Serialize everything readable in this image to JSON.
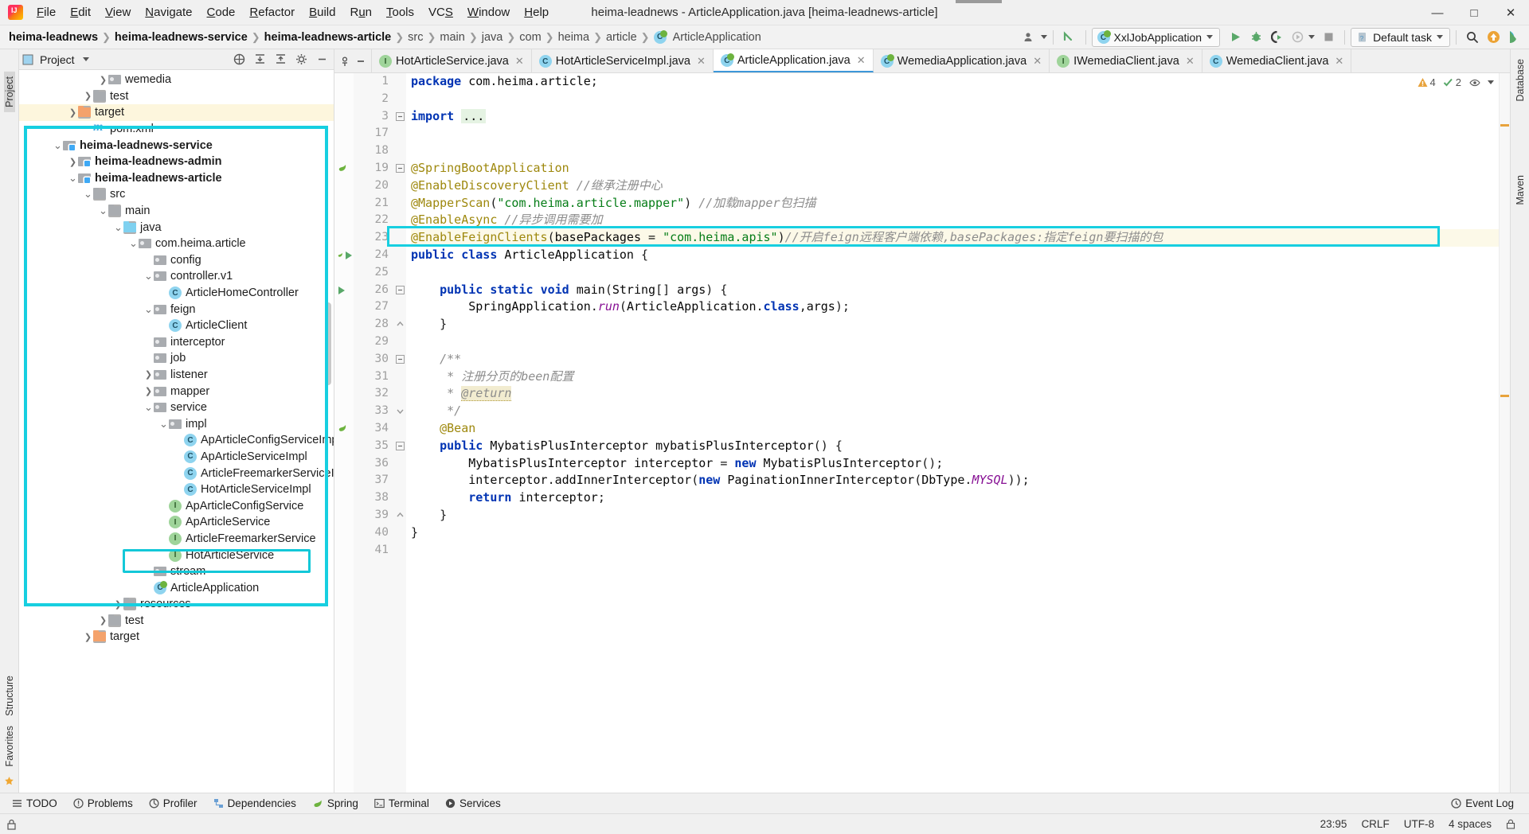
{
  "titlebar": {
    "app_icon": "intellij-logo-icon",
    "menus": [
      "File",
      "Edit",
      "View",
      "Navigate",
      "Code",
      "Refactor",
      "Build",
      "Run",
      "Tools",
      "VCS",
      "Window",
      "Help"
    ],
    "window_title": "heima-leadnews - ArticleApplication.java [heima-leadnews-article]",
    "minimize": "—",
    "maximize": "□",
    "close": "✕"
  },
  "navbar": {
    "breadcrumbs": [
      {
        "label": "heima-leadnews",
        "bold": true
      },
      {
        "label": "heima-leadnews-service",
        "bold": true
      },
      {
        "label": "heima-leadnews-article",
        "bold": true
      },
      {
        "label": "src",
        "bold": false
      },
      {
        "label": "main",
        "bold": false
      },
      {
        "label": "java",
        "bold": false
      },
      {
        "label": "com",
        "bold": false
      },
      {
        "label": "heima",
        "bold": false
      },
      {
        "label": "article",
        "bold": false
      },
      {
        "label": "ArticleApplication",
        "bold": false,
        "icon": "spring-class-icon"
      }
    ],
    "separator": "›",
    "run_config": "XxlJobApplication",
    "task_selector": "Default task",
    "icons": [
      "user-avatar-icon",
      "vcs-update-icon",
      "run-icon",
      "debug-icon",
      "run-coverage-icon",
      "profiler-icon",
      "stop-icon",
      "search-icon",
      "update-icon",
      "ide-icon"
    ]
  },
  "project_panel": {
    "header_title": "Project",
    "header_icons": [
      "collapse-scope-icon",
      "expand-all-icon",
      "collapse-all-icon",
      "settings-gear-icon",
      "hide-icon"
    ],
    "tree": [
      {
        "label": "wemedia",
        "indent": 5,
        "arrow": "collapsed",
        "icon": "package-icon",
        "bold": false
      },
      {
        "label": "test",
        "indent": 4,
        "arrow": "collapsed",
        "icon": "folder-icon",
        "bold": false
      },
      {
        "label": "target",
        "indent": 3,
        "arrow": "collapsed",
        "icon": "folder-target-icon",
        "bold": false,
        "highlight": true
      },
      {
        "label": "pom.xml",
        "indent": 4,
        "arrow": "none",
        "icon": "maven-icon",
        "bold": false
      },
      {
        "label": "heima-leadnews-service",
        "indent": 2,
        "arrow": "expanded",
        "icon": "module-icon",
        "bold": true
      },
      {
        "label": "heima-leadnews-admin",
        "indent": 3,
        "arrow": "collapsed",
        "icon": "module-icon",
        "bold": true
      },
      {
        "label": "heima-leadnews-article",
        "indent": 3,
        "arrow": "expanded",
        "icon": "module-icon",
        "bold": true
      },
      {
        "label": "src",
        "indent": 4,
        "arrow": "expanded",
        "icon": "folder-icon",
        "bold": false
      },
      {
        "label": "main",
        "indent": 5,
        "arrow": "expanded",
        "icon": "folder-icon",
        "bold": false
      },
      {
        "label": "java",
        "indent": 6,
        "arrow": "expanded",
        "icon": "folder-src-icon",
        "bold": false
      },
      {
        "label": "com.heima.article",
        "indent": 7,
        "arrow": "expanded",
        "icon": "package-icon",
        "bold": false
      },
      {
        "label": "config",
        "indent": 8,
        "arrow": "none",
        "icon": "package-icon",
        "bold": false
      },
      {
        "label": "controller.v1",
        "indent": 8,
        "arrow": "expanded",
        "icon": "package-icon",
        "bold": false
      },
      {
        "label": "ArticleHomeController",
        "indent": 9,
        "arrow": "none",
        "icon": "class-icon",
        "bold": false
      },
      {
        "label": "feign",
        "indent": 8,
        "arrow": "expanded",
        "icon": "package-icon",
        "bold": false
      },
      {
        "label": "ArticleClient",
        "indent": 9,
        "arrow": "none",
        "icon": "class-icon",
        "bold": false
      },
      {
        "label": "interceptor",
        "indent": 8,
        "arrow": "none",
        "icon": "package-icon",
        "bold": false
      },
      {
        "label": "job",
        "indent": 8,
        "arrow": "none",
        "icon": "package-icon",
        "bold": false
      },
      {
        "label": "listener",
        "indent": 8,
        "arrow": "collapsed",
        "icon": "package-icon",
        "bold": false
      },
      {
        "label": "mapper",
        "indent": 8,
        "arrow": "collapsed",
        "icon": "package-icon",
        "bold": false
      },
      {
        "label": "service",
        "indent": 8,
        "arrow": "expanded",
        "icon": "package-icon",
        "bold": false
      },
      {
        "label": "impl",
        "indent": 9,
        "arrow": "expanded",
        "icon": "package-icon",
        "bold": false
      },
      {
        "label": "ApArticleConfigServiceImpl",
        "indent": 10,
        "arrow": "none",
        "icon": "class-icon",
        "bold": false
      },
      {
        "label": "ApArticleServiceImpl",
        "indent": 10,
        "arrow": "none",
        "icon": "class-icon",
        "bold": false
      },
      {
        "label": "ArticleFreemarkerServiceImp",
        "indent": 10,
        "arrow": "none",
        "icon": "class-icon",
        "bold": false
      },
      {
        "label": "HotArticleServiceImpl",
        "indent": 10,
        "arrow": "none",
        "icon": "class-icon",
        "bold": false
      },
      {
        "label": "ApArticleConfigService",
        "indent": 9,
        "arrow": "none",
        "icon": "interface-icon",
        "bold": false
      },
      {
        "label": "ApArticleService",
        "indent": 9,
        "arrow": "none",
        "icon": "interface-icon",
        "bold": false
      },
      {
        "label": "ArticleFreemarkerService",
        "indent": 9,
        "arrow": "none",
        "icon": "interface-icon",
        "bold": false
      },
      {
        "label": "HotArticleService",
        "indent": 9,
        "arrow": "none",
        "icon": "interface-icon",
        "bold": false
      },
      {
        "label": "stream",
        "indent": 8,
        "arrow": "none",
        "icon": "package-icon",
        "bold": false
      },
      {
        "label": "ArticleApplication",
        "indent": 8,
        "arrow": "none",
        "icon": "spring-class-icon",
        "bold": false,
        "selected": true
      },
      {
        "label": "resources",
        "indent": 6,
        "arrow": "collapsed",
        "icon": "folder-icon",
        "bold": false
      },
      {
        "label": "test",
        "indent": 5,
        "arrow": "collapsed",
        "icon": "folder-icon",
        "bold": false
      },
      {
        "label": "target",
        "indent": 4,
        "arrow": "collapsed",
        "icon": "folder-target-icon",
        "bold": false
      }
    ]
  },
  "left_strip": {
    "top": "Project",
    "bottom": [
      "Structure",
      "Favorites"
    ]
  },
  "right_strip": {
    "items": [
      "Database",
      "Maven"
    ]
  },
  "editor": {
    "tabs": [
      {
        "label": "HotArticleService.java",
        "icon": "interface-icon",
        "active": false
      },
      {
        "label": "HotArticleServiceImpl.java",
        "icon": "class-icon",
        "active": false
      },
      {
        "label": "ArticleApplication.java",
        "icon": "spring-class-icon",
        "active": true
      },
      {
        "label": "WemediaApplication.java",
        "icon": "spring-class-icon",
        "active": false
      },
      {
        "label": "IWemediaClient.java",
        "icon": "interface-icon",
        "active": false
      },
      {
        "label": "WemediaClient.java",
        "icon": "class-icon",
        "active": false
      }
    ],
    "inspection": {
      "warnings": "4",
      "checks": "2"
    },
    "line_numbers": [
      "1",
      "2",
      "3",
      "17",
      "18",
      "19",
      "20",
      "21",
      "22",
      "23",
      "24",
      "25",
      "26",
      "27",
      "28",
      "29",
      "30",
      "31",
      "32",
      "33",
      "34",
      "35",
      "36",
      "37",
      "38",
      "39",
      "40",
      "41"
    ],
    "code_lines": [
      "package com.heima.article;",
      "",
      "import ...",
      "",
      "",
      "@SpringBootApplication",
      "@EnableDiscoveryClient //继承注册中心",
      "@MapperScan(\"com.heima.article.mapper\") //加载mapper包扫描",
      "@EnableAsync //异步调用需要加",
      "@EnableFeignClients(basePackages = \"com.heima.apis\")//开启feign远程客户端依赖,basePackages:指定feign要扫描的包",
      "public class ArticleApplication {",
      "",
      "    public static void main(String[] args) {",
      "        SpringApplication.run(ArticleApplication.class,args);",
      "    }",
      "",
      "    /**",
      "     * 注册分页的been配置",
      "     * @return",
      "     */",
      "    @Bean",
      "    public MybatisPlusInterceptor mybatisPlusInterceptor() {",
      "        MybatisPlusInterceptor interceptor = new MybatisPlusInterceptor();",
      "        interceptor.addInnerInterceptor(new PaginationInnerInterceptor(DbType.MYSQL));",
      "        return interceptor;",
      "    }",
      "}",
      ""
    ]
  },
  "toolwindow_bar": {
    "items": [
      {
        "label": "TODO",
        "icon": "todo-icon"
      },
      {
        "label": "Problems",
        "icon": "problems-icon"
      },
      {
        "label": "Profiler",
        "icon": "profiler-icon"
      },
      {
        "label": "Dependencies",
        "icon": "dependencies-icon"
      },
      {
        "label": "Spring",
        "icon": "spring-leaf-icon"
      },
      {
        "label": "Terminal",
        "icon": "terminal-icon"
      },
      {
        "label": "Services",
        "icon": "services-icon"
      }
    ],
    "event_log": "Event Log"
  },
  "statusbar": {
    "position": "23:95",
    "line_sep": "CRLF",
    "encoding": "UTF-8",
    "indent": "4 spaces",
    "lock_icon": "lock-icon"
  }
}
